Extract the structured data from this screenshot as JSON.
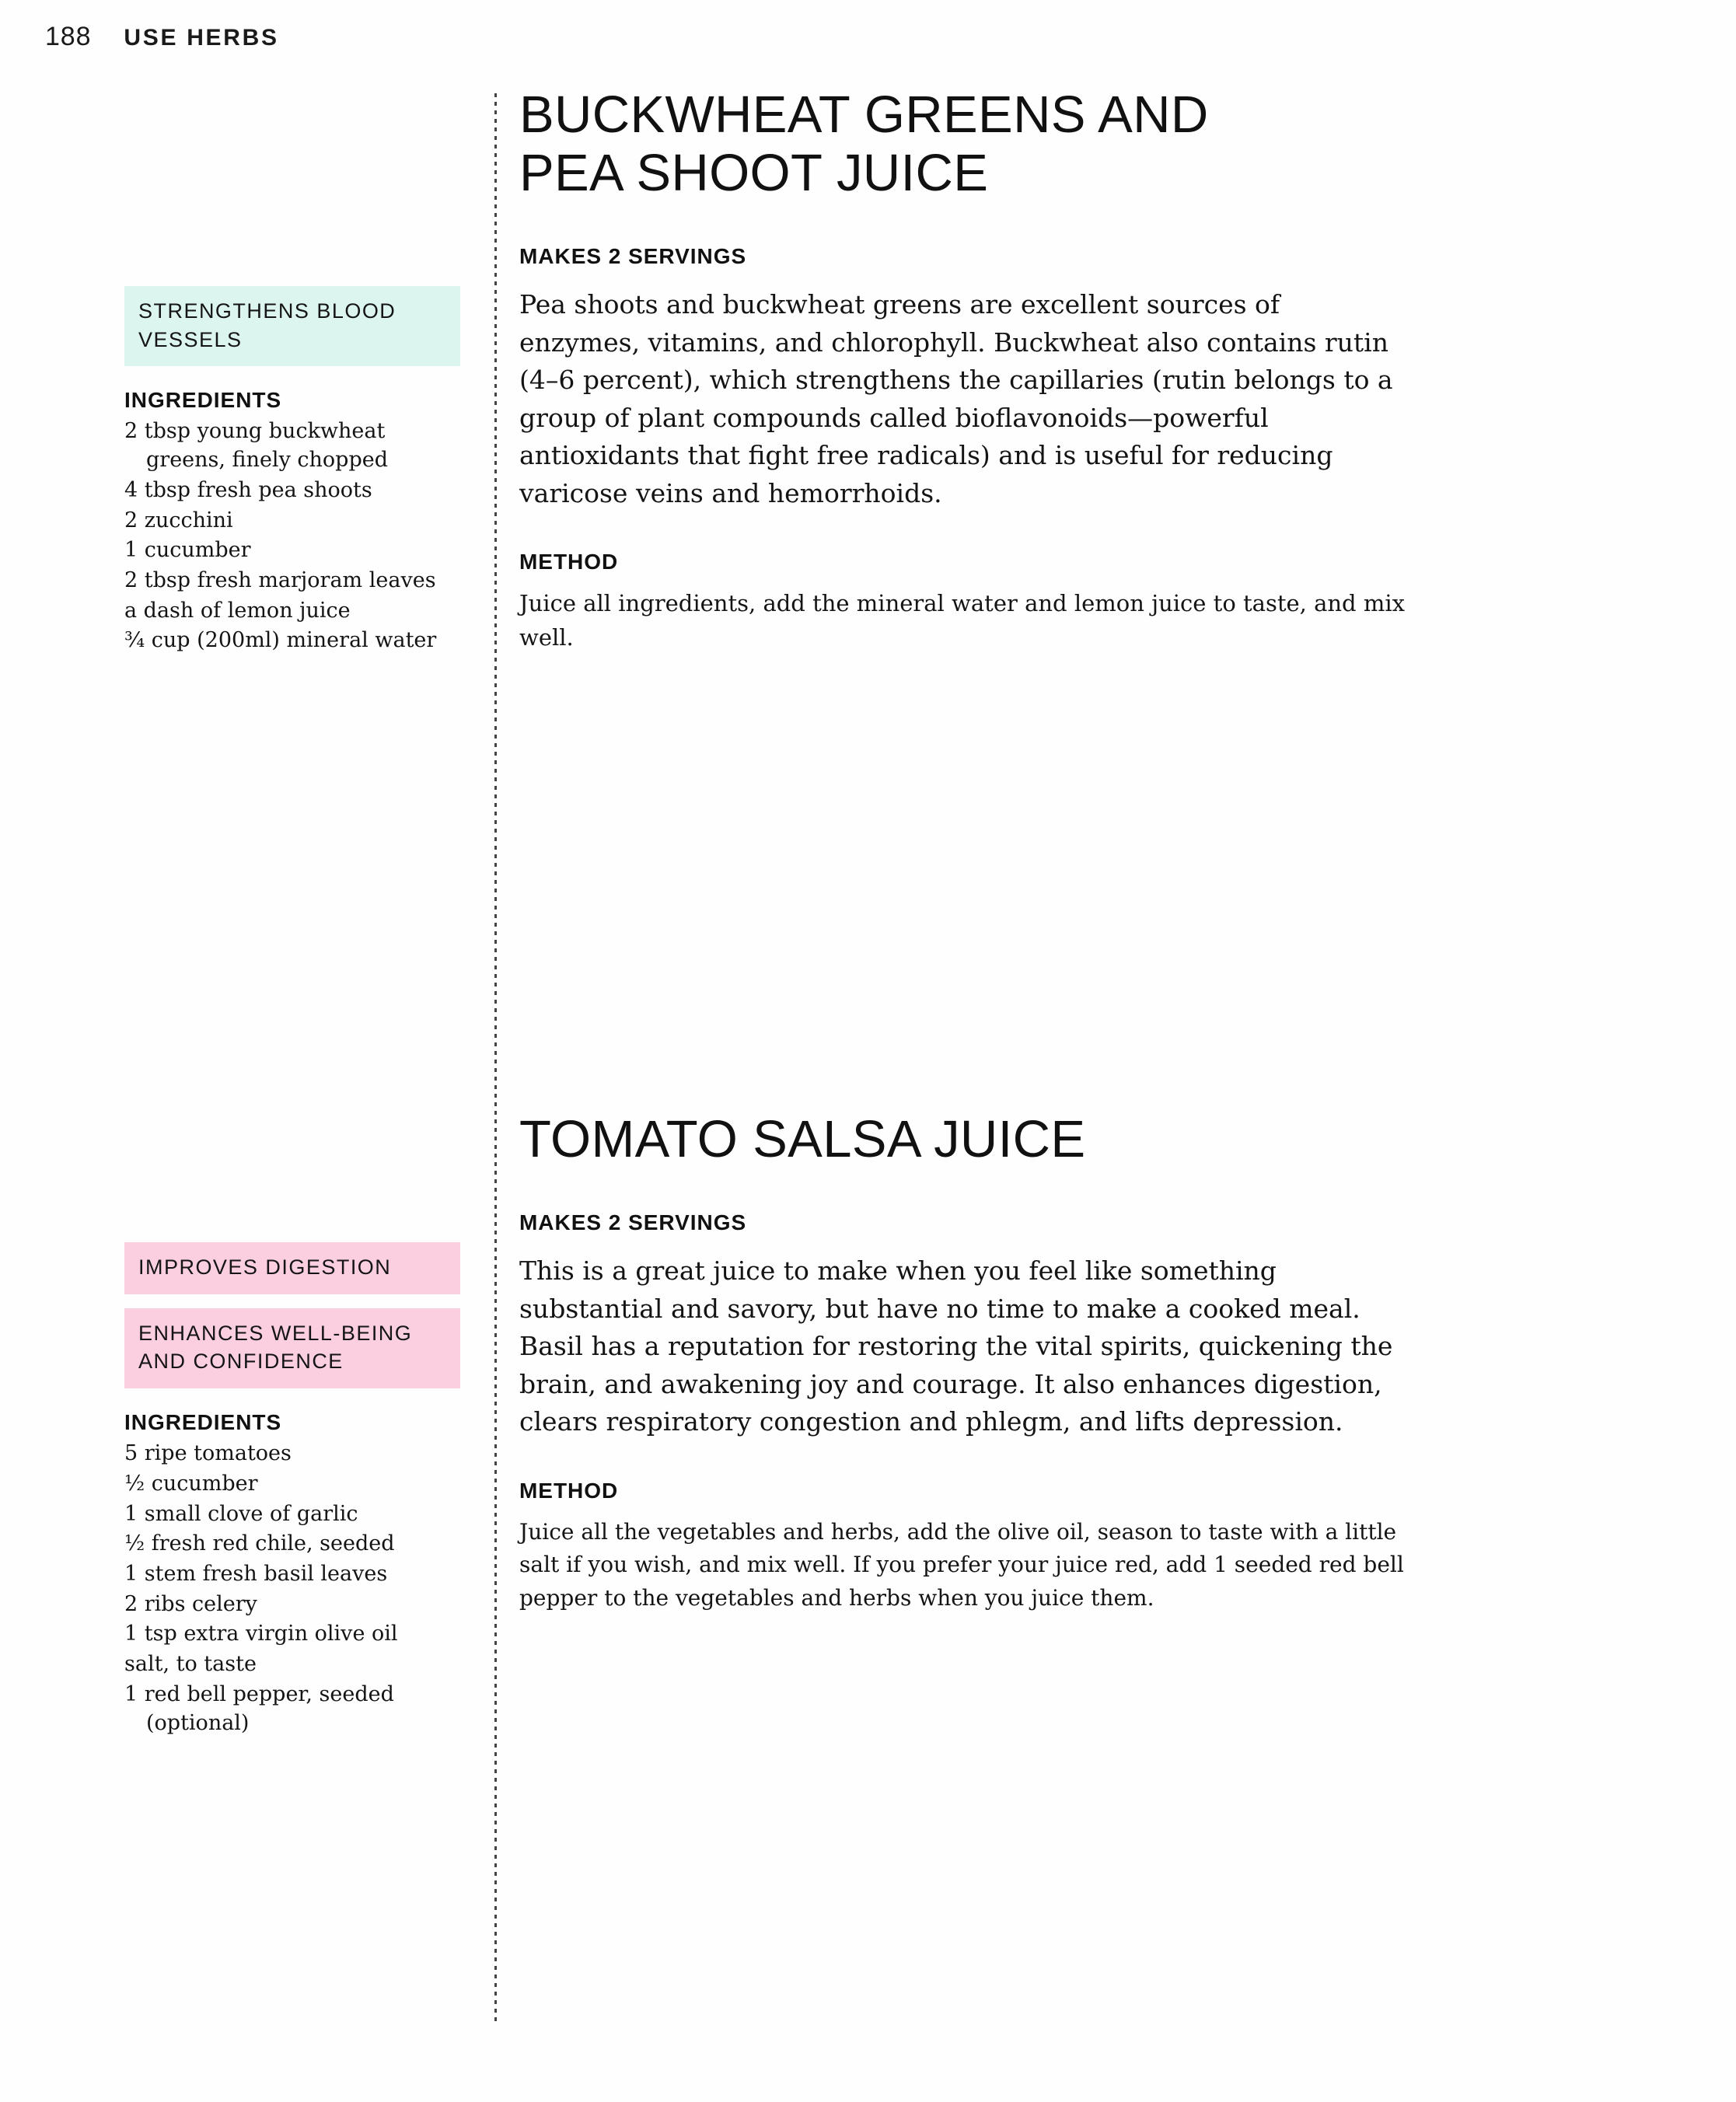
{
  "header": {
    "folio": "188",
    "running_title": "USE HERBS"
  },
  "recipes": [
    {
      "title_lines": [
        "BUCKWHEAT GREENS AND",
        "PEA SHOOT JUICE"
      ],
      "servings": "MAKES 2 SERVINGS",
      "intro": "Pea shoots and buckwheat greens are excellent sources of enzymes, vitamins, and chlorophyll. Buckwheat also contains rutin (4–6 percent), which strengthens the capillaries (rutin belongs to a group of plant compounds called bioflavonoids—powerful antioxidants that fight free radicals) and is useful for reducing varicose veins and hemorrhoids.",
      "method_heading": "METHOD",
      "method": "Juice all ingredients, add the mineral water and lemon juice to taste, and mix well.",
      "tags": [
        {
          "text": "STRENGTHENS BLOOD VESSELS",
          "color": "#dcf5ee",
          "style": "mint"
        }
      ],
      "ingredients_heading": "INGREDIENTS",
      "ingredients": [
        "2 tbsp young buckwheat greens, finely chopped",
        "4 tbsp fresh pea shoots",
        "2 zucchini",
        "1 cucumber",
        "2 tbsp fresh marjoram leaves",
        "a dash of lemon juice",
        "¾ cup (200ml) mineral water"
      ]
    },
    {
      "title_lines": [
        "TOMATO SALSA JUICE"
      ],
      "servings": "MAKES 2 SERVINGS",
      "intro": "This is a great juice to make when you feel like something substantial and savory, but have no time to make a cooked meal. Basil has a reputation for restoring the vital spirits, quickening the brain, and awakening joy and courage. It also enhances digestion, clears respiratory congestion and phlegm, and lifts depression.",
      "method_heading": "METHOD",
      "method": "Juice all the vegetables and herbs, add the olive oil, season to taste with a little salt if you wish, and mix well. If you prefer your juice red, add 1 seeded red bell pepper to the vegetables and herbs when you juice them.",
      "tags": [
        {
          "text": "IMPROVES DIGESTION",
          "color": "#fbcfe0",
          "style": "pink"
        },
        {
          "text": "ENHANCES WELL-BEING AND CONFIDENCE",
          "color": "#fbcfe0",
          "style": "pink"
        }
      ],
      "ingredients_heading": "INGREDIENTS",
      "ingredients": [
        "5 ripe tomatoes",
        "½ cucumber",
        "1 small clove of garlic",
        "½ fresh red chile, seeded",
        "1 stem fresh basil leaves",
        "2 ribs celery",
        "1 tsp extra virgin olive oil",
        "salt, to taste",
        "1 red bell pepper, seeded (optional)"
      ]
    }
  ]
}
